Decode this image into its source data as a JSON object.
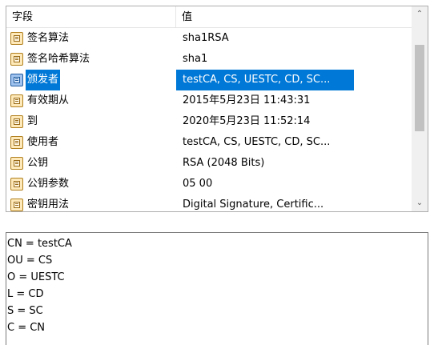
{
  "columns": {
    "field": "字段",
    "value": "值"
  },
  "rows": [
    {
      "field": "签名算法",
      "value": "sha1RSA",
      "selected": false
    },
    {
      "field": "签名哈希算法",
      "value": "sha1",
      "selected": false
    },
    {
      "field": "颁发者",
      "value": "testCA, CS, UESTC, CD, SC...",
      "selected": true
    },
    {
      "field": "有效期从",
      "value": "2015年5月23日 11:43:31",
      "selected": false
    },
    {
      "field": "到",
      "value": "2020年5月23日 11:52:14",
      "selected": false
    },
    {
      "field": "使用者",
      "value": "testCA, CS, UESTC, CD, SC...",
      "selected": false
    },
    {
      "field": "公钥",
      "value": "RSA (2048 Bits)",
      "selected": false
    },
    {
      "field": "公钥参数",
      "value": "05 00",
      "selected": false
    },
    {
      "field": "密钥用法",
      "value": "Digital Signature, Certific...",
      "selected": false
    }
  ],
  "scrollbar": {
    "up_icon": "chevron-up-icon",
    "down_icon": "chevron-down-icon"
  },
  "row_icon": "certificate-field-icon",
  "selection_color": "#0078d7",
  "detail_lines": [
    "CN = testCA",
    "OU = CS",
    "O = UESTC",
    "L = CD",
    "S = SC",
    "C = CN"
  ]
}
